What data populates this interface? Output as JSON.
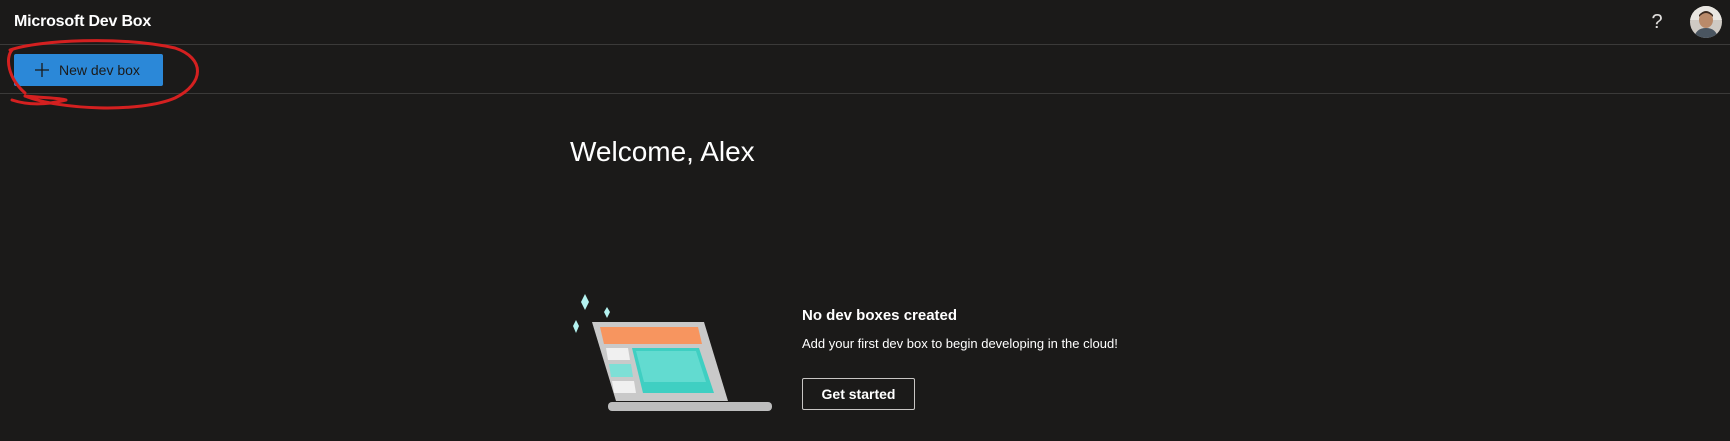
{
  "header": {
    "app_title": "Microsoft Dev Box",
    "help_glyph": "?",
    "help_icon": "question-mark-icon",
    "avatar_icon": "user-avatar"
  },
  "toolbar": {
    "new_label": "New dev box",
    "new_icon": "plus-icon"
  },
  "main": {
    "welcome": "Welcome, Alex",
    "empty_state": {
      "title": "No dev boxes created",
      "description": "Add your first dev box to begin developing in the cloud!",
      "cta_label": "Get started",
      "illustration": "laptop-illustration"
    }
  },
  "colors": {
    "background": "#1b1a19",
    "primary": "#2b88d8",
    "annotation": "#d42020",
    "divider": "#3b3a39"
  }
}
